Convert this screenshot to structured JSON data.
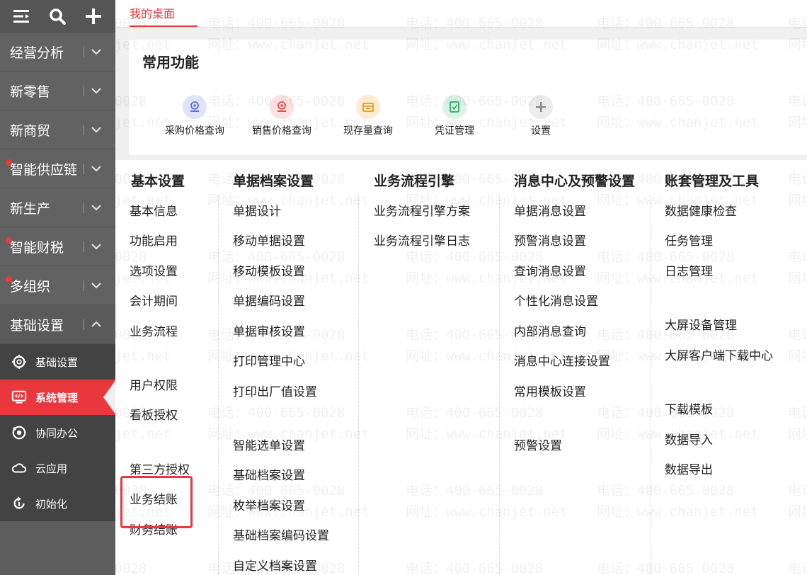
{
  "sidebar": {
    "top_icons": [
      "menu-toggle-icon",
      "search-icon",
      "plus-icon"
    ],
    "items": [
      {
        "label": "经营分析",
        "dot": false
      },
      {
        "label": "新零售",
        "dot": false
      },
      {
        "label": "新商贸",
        "dot": false
      },
      {
        "label": "智能供应链",
        "dot": true
      },
      {
        "label": "新生产",
        "dot": false
      },
      {
        "label": "智能财税",
        "dot": true
      },
      {
        "label": "多组织",
        "dot": true
      },
      {
        "label": "基础设置",
        "dot": false
      }
    ],
    "submenu": [
      {
        "label": "基础设置",
        "icon": "gear-icon"
      },
      {
        "label": "系统管理",
        "icon": "monitor-code-icon"
      },
      {
        "label": "协同办公",
        "icon": "collab-icon"
      },
      {
        "label": "云应用",
        "icon": "cloud-icon"
      },
      {
        "label": "初始化",
        "icon": "refresh-icon"
      }
    ]
  },
  "tabs": {
    "active": "我的桌面"
  },
  "quick": {
    "title": "常用功能",
    "items": [
      {
        "label": "采购价格查询",
        "icon": "purchase-price-icon",
        "color": "#dfe3fb"
      },
      {
        "label": "销售价格查询",
        "icon": "sales-price-icon",
        "color": "#fde0e0"
      },
      {
        "label": "现存量查询",
        "icon": "stock-icon",
        "color": "#fdebd2"
      },
      {
        "label": "凭证管理",
        "icon": "voucher-icon",
        "color": "#d9f3e6"
      },
      {
        "label": "设置",
        "icon": "plus-icon",
        "color": "#ececec"
      }
    ]
  },
  "settings": {
    "cols": [
      {
        "head": "基本设置",
        "links": [
          "基本信息",
          "功能启用",
          "选项设置",
          "会计期间",
          "业务流程",
          "用户权限",
          "看板授权",
          "第三方授权",
          "业务结账",
          "财务结账"
        ]
      },
      {
        "head": "单据档案设置",
        "links": [
          "单据设计",
          "移动单据设置",
          "移动模板设置",
          "单据编码设置",
          "单据审核设置",
          "打印管理中心",
          "打印出厂值设置",
          "智能选单设置",
          "基础档案设置",
          "枚举档案设置",
          "基础档案编码设置",
          "自定义档案设置"
        ]
      },
      {
        "head": "业务流程引擎",
        "links": [
          "业务流程引擎方案",
          "业务流程引擎日志"
        ]
      },
      {
        "head": "消息中心及预警设置",
        "links": [
          "单据消息设置",
          "预警消息设置",
          "查询消息设置",
          "个性化消息设置",
          "内部消息查询",
          "消息中心连接设置",
          "常用模板设置",
          "预警设置"
        ]
      },
      {
        "head": "账套管理及工具",
        "links": [
          "数据健康检查",
          "任务管理",
          "日志管理",
          "大屏设备管理",
          "大屏客户端下载中心",
          "下载模板",
          "数据导入",
          "数据导出"
        ]
      }
    ]
  },
  "watermark": {
    "phone": "电话：400-665-0028",
    "site": "网址：www.chanjet.net"
  }
}
